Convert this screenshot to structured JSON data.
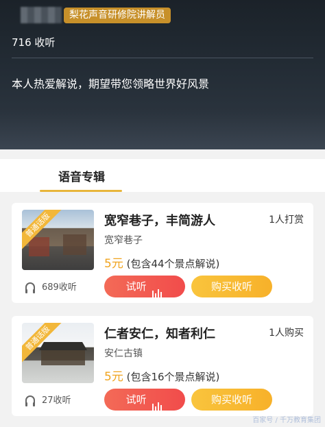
{
  "header": {
    "role_badge": "梨花声音研修院讲解员",
    "listen_count": "716 收听",
    "intro": "本人热爱解说，期望带您领略世界好风景"
  },
  "tabs": {
    "active": "语音专辑"
  },
  "albums": [
    {
      "ribbon": "普通话版",
      "title": "宽窄巷子，丰简游人",
      "tag": "1人打赏",
      "subtitle": "宽窄巷子",
      "price_amount": "5元",
      "price_note": "(包含44个景点解说)",
      "listen_label": "试听",
      "buy_label": "购买收听",
      "plays": "689收听"
    },
    {
      "ribbon": "普通话版",
      "title": "仁者安仁，知者利仁",
      "tag": "1人购买",
      "subtitle": "安仁古镇",
      "price_amount": "5元",
      "price_note": "(包含16个景点解说)",
      "listen_label": "试听",
      "buy_label": "购买收听",
      "plays": "27收听"
    }
  ],
  "watermark": "百家号 / 千万教育集团",
  "colors": {
    "accent": "#f7b12a",
    "listen_button": "#f14c4b",
    "badge": "#c7902a"
  }
}
